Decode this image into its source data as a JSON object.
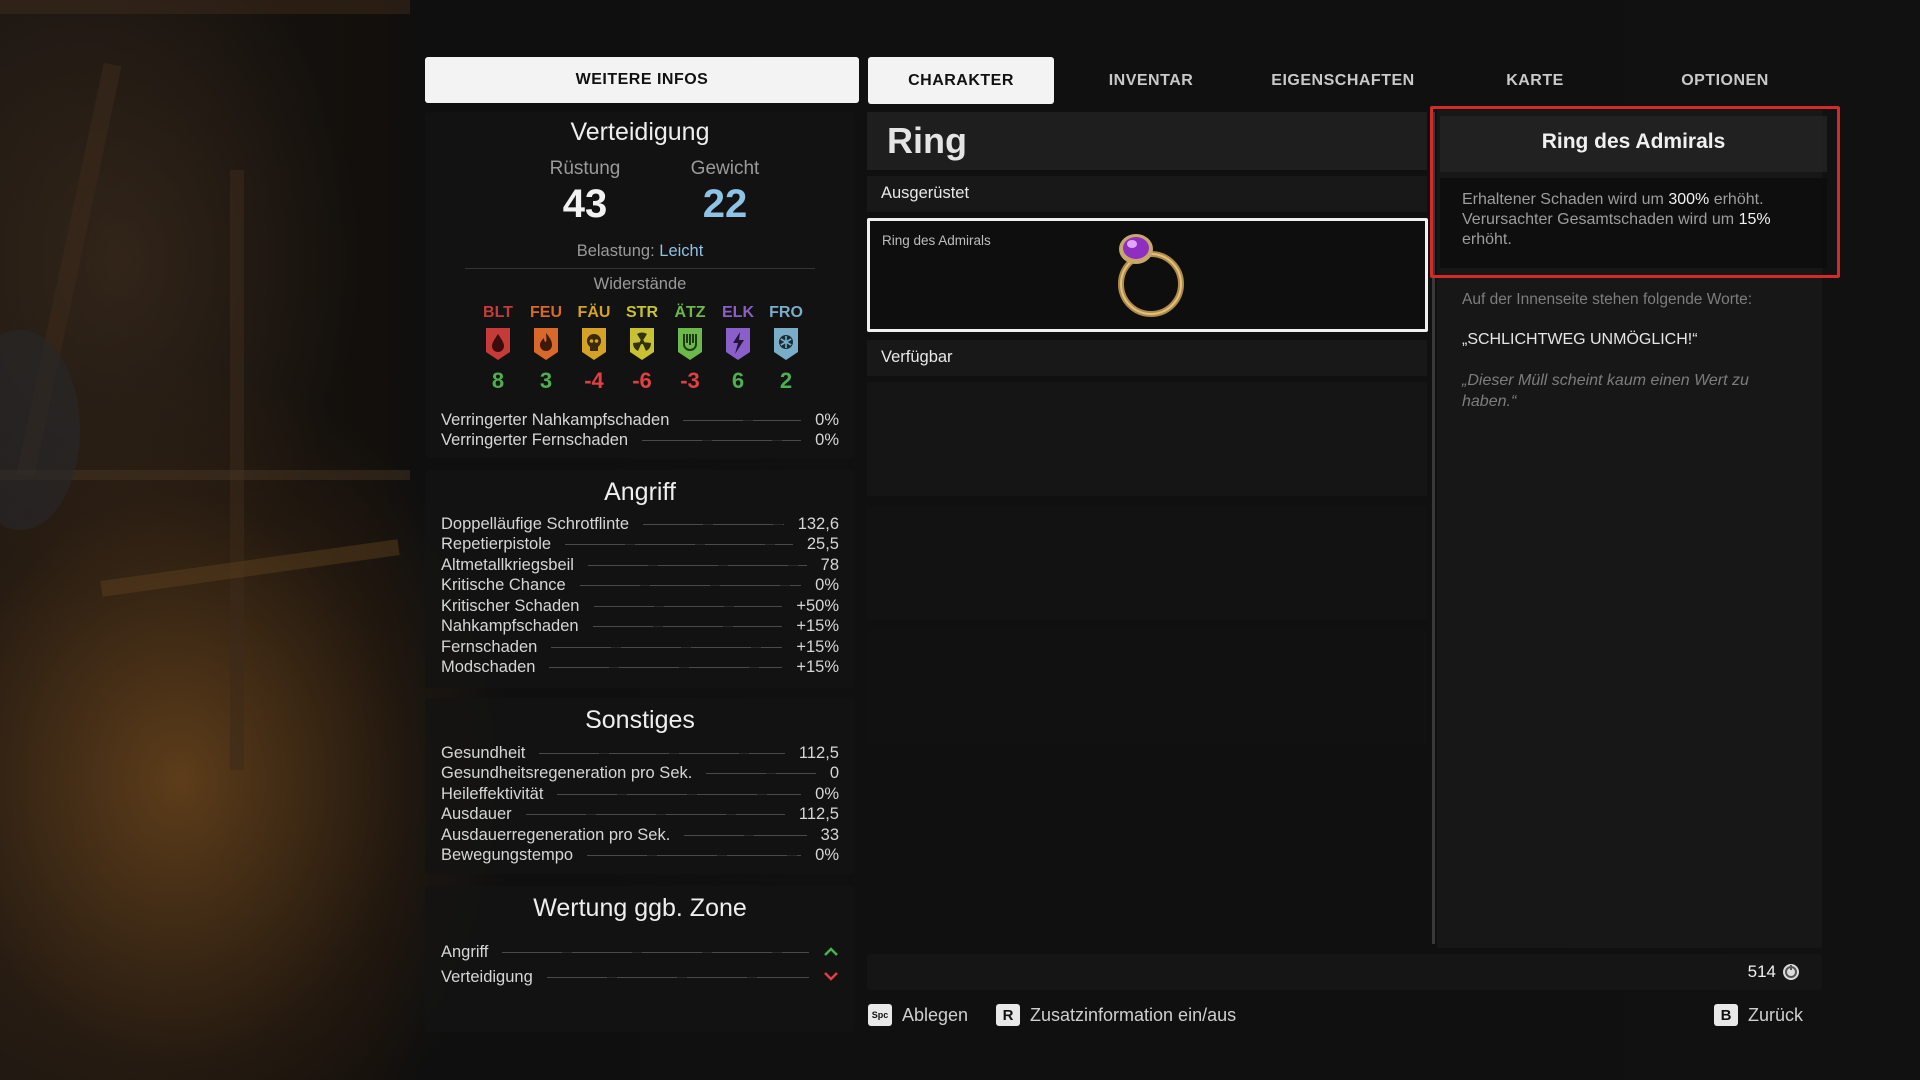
{
  "tabs": [
    {
      "label": "WEITERE INFOS"
    },
    {
      "label": "CHARAKTER"
    },
    {
      "label": "INVENTAR"
    },
    {
      "label": "EIGENSCHAFTEN"
    },
    {
      "label": "KARTE"
    },
    {
      "label": "OPTIONEN"
    }
  ],
  "defense": {
    "title": "Verteidigung",
    "armor_label": "Rüstung",
    "armor_value": "43",
    "weight_label": "Gewicht",
    "weight_value": "22",
    "load_label": "Belastung:",
    "load_value": "Leicht",
    "resist_title": "Widerstände",
    "resistances": [
      {
        "code": "BLT",
        "value": "8",
        "color": "#c63a3a",
        "value_color": "#4caf50",
        "icon": "blood-drop-icon"
      },
      {
        "code": "FEU",
        "value": "3",
        "color": "#d9692a",
        "value_color": "#4caf50",
        "icon": "fire-icon"
      },
      {
        "code": "FÄU",
        "value": "-4",
        "color": "#d4a224",
        "value_color": "#e04040",
        "icon": "skull-icon"
      },
      {
        "code": "STR",
        "value": "-6",
        "color": "#c8c232",
        "value_color": "#e04040",
        "icon": "radiation-icon"
      },
      {
        "code": "ÄTZ",
        "value": "-3",
        "color": "#6db84a",
        "value_color": "#e04040",
        "icon": "acid-icon"
      },
      {
        "code": "ELK",
        "value": "6",
        "color": "#8a5fc9",
        "value_color": "#4caf50",
        "icon": "lightning-icon"
      },
      {
        "code": "FRO",
        "value": "2",
        "color": "#7aaec8",
        "value_color": "#4caf50",
        "icon": "snowflake-icon"
      }
    ],
    "reductions": [
      {
        "label": "Verringerter Nahkampfschaden",
        "value": "0%"
      },
      {
        "label": "Verringerter Fernschaden",
        "value": "0%"
      }
    ]
  },
  "attack": {
    "title": "Angriff",
    "rows": [
      {
        "label": "Doppelläufige Schrotflinte",
        "value": "132,6"
      },
      {
        "label": "Repetierpistole",
        "value": "25,5"
      },
      {
        "label": "Altmetallkriegsbeil",
        "value": "78"
      },
      {
        "label": "Kritische Chance",
        "value": "0%"
      },
      {
        "label": "Kritischer Schaden",
        "value": "+50%"
      },
      {
        "label": "Nahkampfschaden",
        "value": "+15%"
      },
      {
        "label": "Fernschaden",
        "value": "+15%"
      },
      {
        "label": "Modschaden",
        "value": "+15%"
      }
    ]
  },
  "misc": {
    "title": "Sonstiges",
    "rows": [
      {
        "label": "Gesundheit",
        "value": "112,5"
      },
      {
        "label": "Gesundheitsregeneration pro Sek.",
        "value": "0"
      },
      {
        "label": "Heileffektivität",
        "value": "0%"
      },
      {
        "label": "Ausdauer",
        "value": "112,5"
      },
      {
        "label": "Ausdauerregeneration pro Sek.",
        "value": "33"
      },
      {
        "label": "Bewegungstempo",
        "value": "0%"
      }
    ]
  },
  "zone": {
    "title": "Wertung ggb. Zone",
    "rows": [
      {
        "label": "Angriff",
        "indicator": "up"
      },
      {
        "label": "Verteidigung",
        "indicator": "down"
      }
    ]
  },
  "category": {
    "title": "Ring",
    "equipped_label": "Ausgerüstet",
    "equipped_item": "Ring des Admirals",
    "available_label": "Verfügbar"
  },
  "detail": {
    "title": "Ring des Admirals",
    "desc_line1_pre": "Erhaltener Schaden wird um ",
    "desc_line1_value": "300%",
    "desc_line1_post": " erhöht.",
    "desc_line2_pre": "Verursachter Gesamtschaden wird um ",
    "desc_line2_value": "15%",
    "desc_line3": "erhöht.",
    "inscription_intro": "Auf der Innenseite stehen folgende Worte:",
    "inscription": "„SCHLICHTWEG UNMÖGLICH!“",
    "flavor_line1": "„Dieser Müll scheint kaum einen Wert zu",
    "flavor_line2": "haben.“"
  },
  "currency": {
    "value": "514",
    "icon": "scrap-coin-icon"
  },
  "footer": {
    "drop_key": "Spc",
    "drop_label": "Ablegen",
    "info_key": "R",
    "info_label": "Zusatzinformation ein/aus",
    "back_key": "B",
    "back_label": "Zurück"
  },
  "colors": {
    "highlight_border": "#d42a2a",
    "accent_blue": "#8ec3e6",
    "positive": "#4caf50",
    "negative": "#e04040"
  }
}
